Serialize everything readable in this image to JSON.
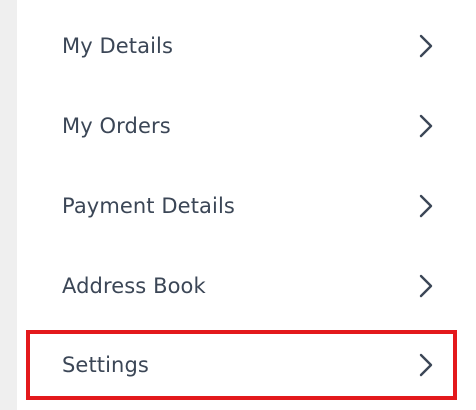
{
  "menu": {
    "items": [
      {
        "label": "My Details",
        "icon": "chevron-right-icon"
      },
      {
        "label": "My Orders",
        "icon": "chevron-right-icon"
      },
      {
        "label": "Payment Details",
        "icon": "chevron-right-icon"
      },
      {
        "label": "Address Book",
        "icon": "chevron-right-icon"
      },
      {
        "label": "Settings",
        "icon": "chevron-right-icon",
        "highlighted": true
      }
    ]
  },
  "colors": {
    "text": "#3b4656",
    "chevron": "#3b4656",
    "highlight_border": "#e3191c",
    "gutter": "#efefef"
  }
}
